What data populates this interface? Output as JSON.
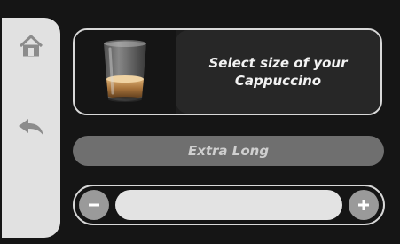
{
  "sidebar": {
    "home_icon": "home-icon",
    "back_icon": "back-arrow-icon"
  },
  "card": {
    "message": "Select size of your Cappuccino",
    "cup_icon": "espresso-cup-icon"
  },
  "size": {
    "label": "Extra Long"
  },
  "stepper": {
    "minus_icon": "minus-icon",
    "plus_icon": "plus-icon"
  },
  "colors": {
    "background": "#151515",
    "sidebar": "#e1e1e1",
    "panel": "#272727",
    "size_bar": "#6f6f6f",
    "track": "#e3e3e3",
    "step_button": "#9a9a9a"
  }
}
